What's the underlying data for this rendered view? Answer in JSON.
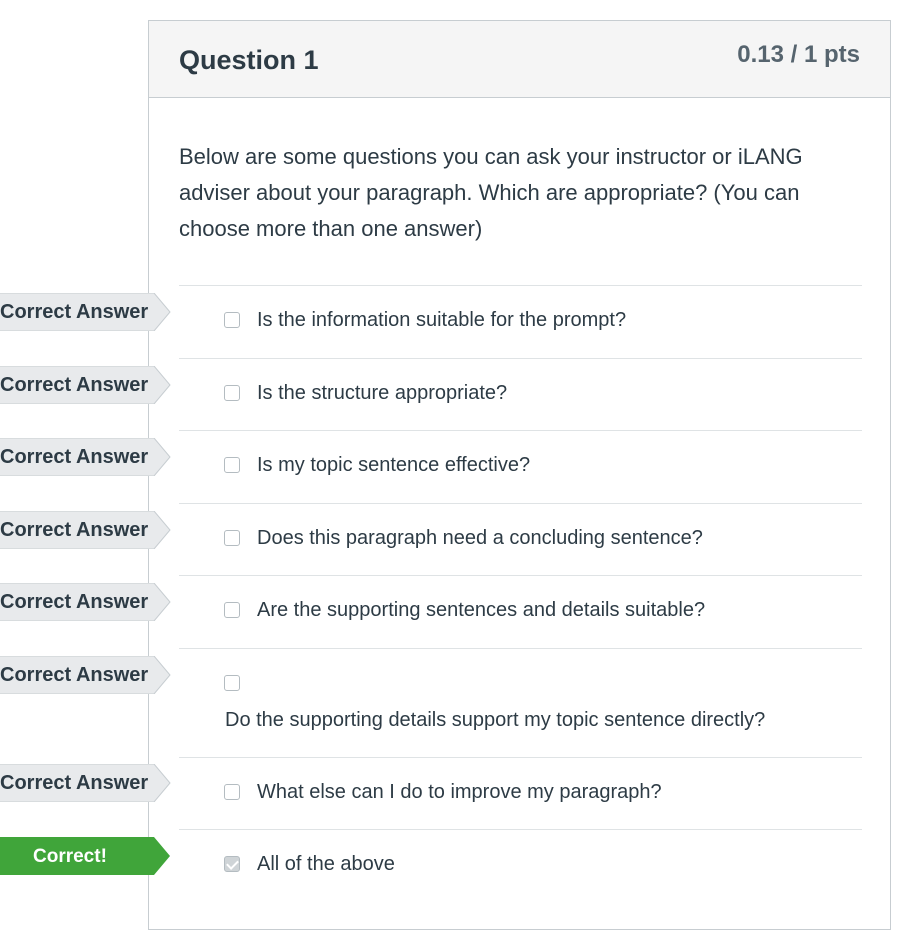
{
  "question": {
    "title": "Question 1",
    "points": "0.13 / 1 pts",
    "text": "Below are some questions you can ask your instructor or iLANG adviser about your paragraph. Which are appropriate? (You can choose more than one answer)"
  },
  "answers": [
    {
      "label": "Is the information suitable for the prompt?",
      "checked": false,
      "flag": "Correct Answer"
    },
    {
      "label": "Is the structure appropriate?",
      "checked": false,
      "flag": "Correct Answer"
    },
    {
      "label": "Is my topic sentence effective?",
      "checked": false,
      "flag": "Correct Answer"
    },
    {
      "label": "Does this paragraph need a concluding sentence?",
      "checked": false,
      "flag": "Correct Answer"
    },
    {
      "label": "Are the supporting sentences and details suitable?",
      "checked": false,
      "flag": "Correct Answer"
    },
    {
      "label": "Do the supporting details support my topic sentence directly?",
      "checked": false,
      "flag": "Correct Answer"
    },
    {
      "label": "What else can I do to improve my paragraph?",
      "checked": false,
      "flag": "Correct Answer"
    },
    {
      "label": "All of the above",
      "checked": true,
      "flag": "Correct!"
    }
  ],
  "colors": {
    "flag_gray": "#e8eaec",
    "flag_green": "#40a53a",
    "text": "#2d3b45",
    "border": "#c7cdd1"
  }
}
